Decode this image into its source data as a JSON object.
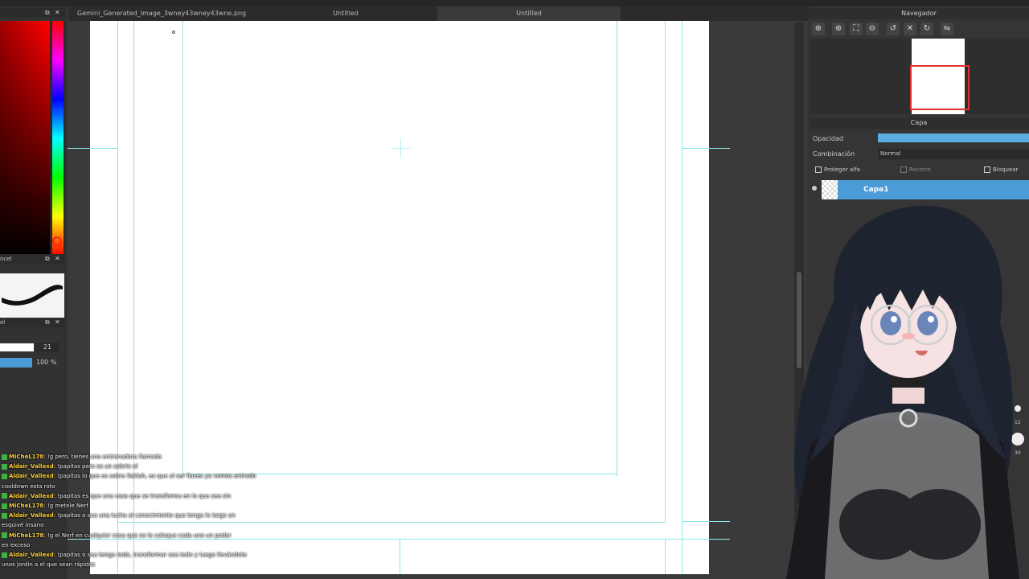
{
  "tabs": [
    {
      "label": "Gemini_Generated_Image_3wney43wney43wne.png",
      "active": false
    },
    {
      "label": "Untitled",
      "active": false
    },
    {
      "label": "Untitled",
      "active": true
    }
  ],
  "left_panel": {
    "brush_header": "ncel",
    "size_header": "el",
    "brush_size": "21",
    "opacity": "100 %"
  },
  "navigator": {
    "title": "Navegador",
    "tools": [
      "zoom-in-icon",
      "zoom-in-icon",
      "fit-icon",
      "zoom-out-icon",
      "rotate-left-icon",
      "fullscreen-icon",
      "rotate-right-icon",
      "flip-icon"
    ]
  },
  "layers": {
    "title": "Capa",
    "opacity_label": "Opacidad",
    "opacity_value": 1.0,
    "blend_label": "Combinación",
    "blend_value": "Normal",
    "protect_alpha": "Proteger alfa",
    "clip": "Recorte",
    "lock": "Bloquear",
    "items": [
      {
        "name": "Capa1",
        "selected": true
      }
    ]
  },
  "dial": {
    "small": "12",
    "large": "30"
  },
  "chat": [
    {
      "user": "MiCheL178",
      "text": ": !g pero, tienes una entrenadora llamada"
    },
    {
      "user": "Aldair_Vallexd",
      "text": ": !papitas pero es un sobrio el"
    },
    {
      "user": "Aldair_Vallexd",
      "text": ": !papitas lo que es sobre llaklah, es que al ser llaves ya vemos entrado"
    },
    {
      "user": "",
      "text": "cooldown esta roto"
    },
    {
      "user": "Aldair_Vallexd",
      "text": ": !papitas es que una cosa que se transforma en lo que sea sin"
    },
    {
      "user": "MiCheL178",
      "text": ": !g metele Nerf"
    },
    {
      "user": "Aldair_Vallexd",
      "text": ": !papitas o sea una lucha al conocimiento que tenga lo largo un"
    },
    {
      "user": "",
      "text": "esquivé insano"
    },
    {
      "user": "MiCheL178",
      "text": ": !g el Nerf en cualquier cosa que se le coloque cada uno un poder"
    },
    {
      "user": "",
      "text": "en exceso"
    },
    {
      "user": "Aldair_Vallexd",
      "text": ": !papitas o sea tenga todo, transformar sea todo y luego llevándote"
    },
    {
      "user": "",
      "text": "unos jordin a el que sean rápidos"
    }
  ],
  "colors": {
    "accent": "#4a9bd6",
    "guide": "#8fe6e6",
    "nav_rect": "#e03030",
    "chat_user": "#ffcf3a"
  }
}
